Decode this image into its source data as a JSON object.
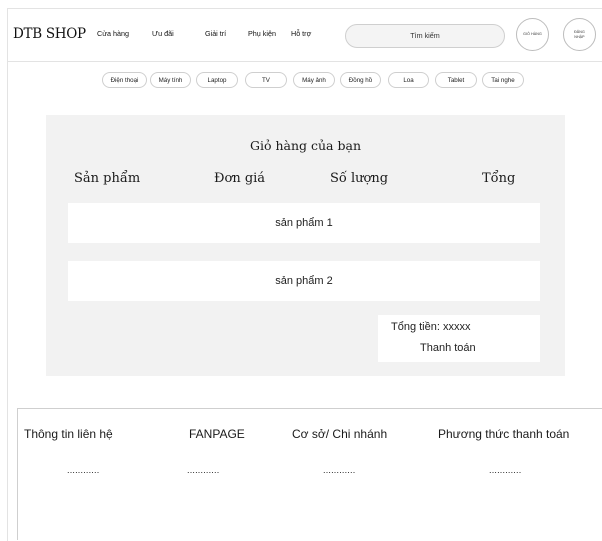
{
  "header": {
    "logo": "DTB SHOP",
    "nav": [
      "Cửa hàng",
      "Ưu đãi",
      "Giải trí",
      "Phụ kiện",
      "Hỗ trợ"
    ],
    "search_placeholder": "Tìm kiếm",
    "cart_button": "GIỎ HÀNG",
    "login_button": "ĐĂNG NHẬP"
  },
  "categories": [
    "Điện thoại",
    "Máy tính",
    "Laptop",
    "TV",
    "Máy ảnh",
    "Đồng hồ",
    "Loa",
    "Tablet",
    "Tai nghe"
  ],
  "cart": {
    "title": "Giỏ hàng của bạn",
    "columns": [
      "Sản phẩm",
      "Đơn giá",
      "Số lượng",
      "Tổng"
    ],
    "items": [
      "sản phẩm 1",
      "sản phẩm 2"
    ],
    "total_label": "Tổng tiền: xxxxx",
    "checkout_label": "Thanh toán"
  },
  "footer": {
    "columns": [
      {
        "title": "Thông tin liên hệ",
        "value": "............"
      },
      {
        "title": "FANPAGE",
        "value": "............"
      },
      {
        "title": "Cơ sở/ Chi nhánh",
        "value": "............"
      },
      {
        "title": "Phương thức thanh toán",
        "value": "............"
      }
    ]
  }
}
